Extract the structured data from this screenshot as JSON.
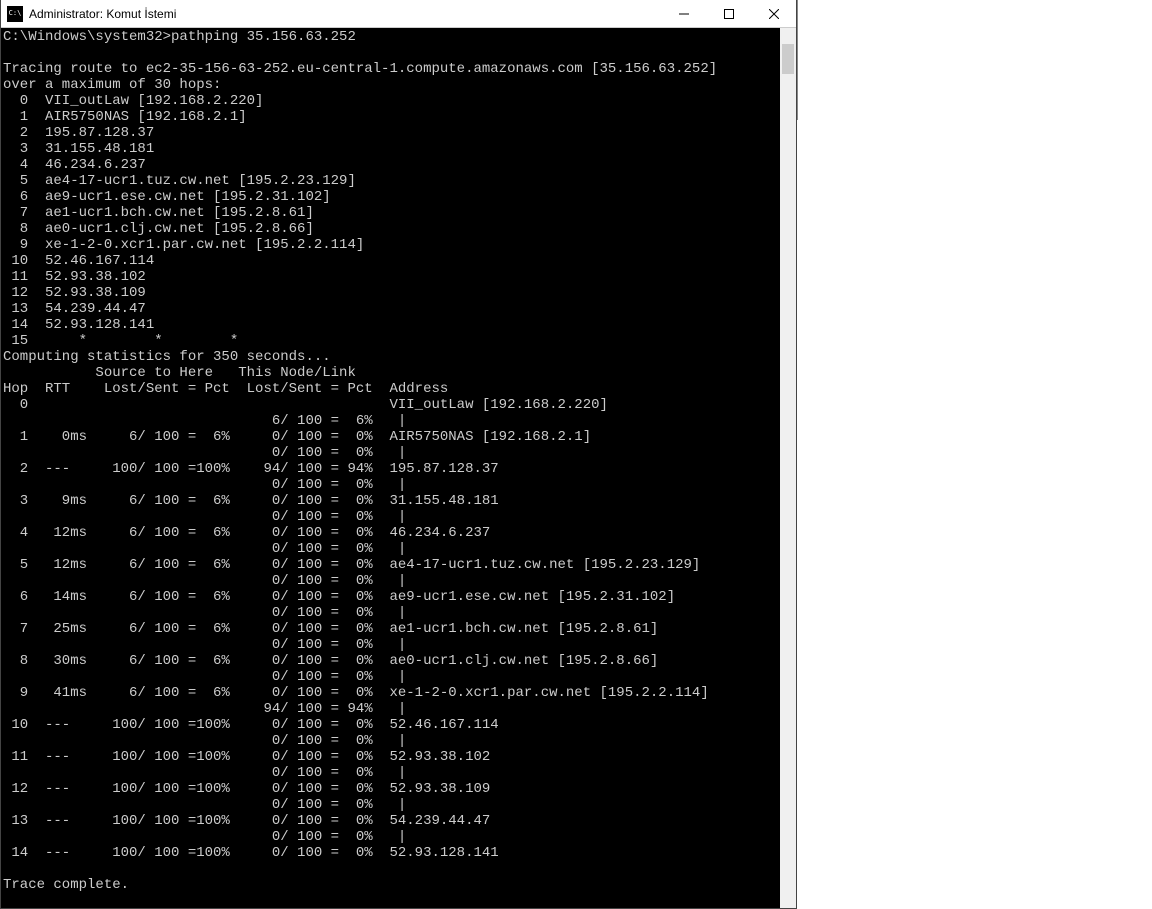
{
  "window": {
    "title": "Administrator: Komut İstemi"
  },
  "prompt": {
    "path": "C:\\Windows\\system32>",
    "command": "pathping 35.156.63.252"
  },
  "trace_header": {
    "line1": "Tracing route to ec2-35-156-63-252.eu-central-1.compute.amazonaws.com [35.156.63.252]",
    "line2": "over a maximum of 30 hops:"
  },
  "hops": [
    {
      "n": "0",
      "text": "VII_outLaw [192.168.2.220]"
    },
    {
      "n": "1",
      "text": "AIR5750NAS [192.168.2.1]"
    },
    {
      "n": "2",
      "text": "195.87.128.37"
    },
    {
      "n": "3",
      "text": "31.155.48.181"
    },
    {
      "n": "4",
      "text": "46.234.6.237"
    },
    {
      "n": "5",
      "text": "ae4-17-ucr1.tuz.cw.net [195.2.23.129]"
    },
    {
      "n": "6",
      "text": "ae9-ucr1.ese.cw.net [195.2.31.102]"
    },
    {
      "n": "7",
      "text": "ae1-ucr1.bch.cw.net [195.2.8.61]"
    },
    {
      "n": "8",
      "text": "ae0-ucr1.clj.cw.net [195.2.8.66]"
    },
    {
      "n": "9",
      "text": "xe-1-2-0.xcr1.par.cw.net [195.2.2.114]"
    },
    {
      "n": "10",
      "text": "52.46.167.114"
    },
    {
      "n": "11",
      "text": "52.93.38.102"
    },
    {
      "n": "12",
      "text": "52.93.38.109"
    },
    {
      "n": "13",
      "text": "54.239.44.47"
    },
    {
      "n": "14",
      "text": "52.93.128.141"
    },
    {
      "n": "15",
      "text": "    *        *        *"
    }
  ],
  "computing": "Computing statistics for 350 seconds...",
  "stats_header": {
    "line1": "           Source to Here   This Node/Link",
    "line2": "Hop  RTT    Lost/Sent = Pct  Lost/Sent = Pct  Address"
  },
  "stats_rows": [
    {
      "l": "  0                                           VII_outLaw [192.168.2.220]"
    },
    {
      "l": "                                6/ 100 =  6%   |"
    },
    {
      "l": "  1    0ms     6/ 100 =  6%     0/ 100 =  0%  AIR5750NAS [192.168.2.1]"
    },
    {
      "l": "                                0/ 100 =  0%   |"
    },
    {
      "l": "  2  ---     100/ 100 =100%    94/ 100 = 94%  195.87.128.37"
    },
    {
      "l": "                                0/ 100 =  0%   |"
    },
    {
      "l": "  3    9ms     6/ 100 =  6%     0/ 100 =  0%  31.155.48.181"
    },
    {
      "l": "                                0/ 100 =  0%   |"
    },
    {
      "l": "  4   12ms     6/ 100 =  6%     0/ 100 =  0%  46.234.6.237"
    },
    {
      "l": "                                0/ 100 =  0%   |"
    },
    {
      "l": "  5   12ms     6/ 100 =  6%     0/ 100 =  0%  ae4-17-ucr1.tuz.cw.net [195.2.23.129]"
    },
    {
      "l": "                                0/ 100 =  0%   |"
    },
    {
      "l": "  6   14ms     6/ 100 =  6%     0/ 100 =  0%  ae9-ucr1.ese.cw.net [195.2.31.102]"
    },
    {
      "l": "                                0/ 100 =  0%   |"
    },
    {
      "l": "  7   25ms     6/ 100 =  6%     0/ 100 =  0%  ae1-ucr1.bch.cw.net [195.2.8.61]"
    },
    {
      "l": "                                0/ 100 =  0%   |"
    },
    {
      "l": "  8   30ms     6/ 100 =  6%     0/ 100 =  0%  ae0-ucr1.clj.cw.net [195.2.8.66]"
    },
    {
      "l": "                                0/ 100 =  0%   |"
    },
    {
      "l": "  9   41ms     6/ 100 =  6%     0/ 100 =  0%  xe-1-2-0.xcr1.par.cw.net [195.2.2.114]"
    },
    {
      "l": "                               94/ 100 = 94%   |"
    },
    {
      "l": " 10  ---     100/ 100 =100%     0/ 100 =  0%  52.46.167.114"
    },
    {
      "l": "                                0/ 100 =  0%   |"
    },
    {
      "l": " 11  ---     100/ 100 =100%     0/ 100 =  0%  52.93.38.102"
    },
    {
      "l": "                                0/ 100 =  0%   |"
    },
    {
      "l": " 12  ---     100/ 100 =100%     0/ 100 =  0%  52.93.38.109"
    },
    {
      "l": "                                0/ 100 =  0%   |"
    },
    {
      "l": " 13  ---     100/ 100 =100%     0/ 100 =  0%  54.239.44.47"
    },
    {
      "l": "                                0/ 100 =  0%   |"
    },
    {
      "l": " 14  ---     100/ 100 =100%     0/ 100 =  0%  52.93.128.141"
    }
  ],
  "trace_complete": "Trace complete."
}
